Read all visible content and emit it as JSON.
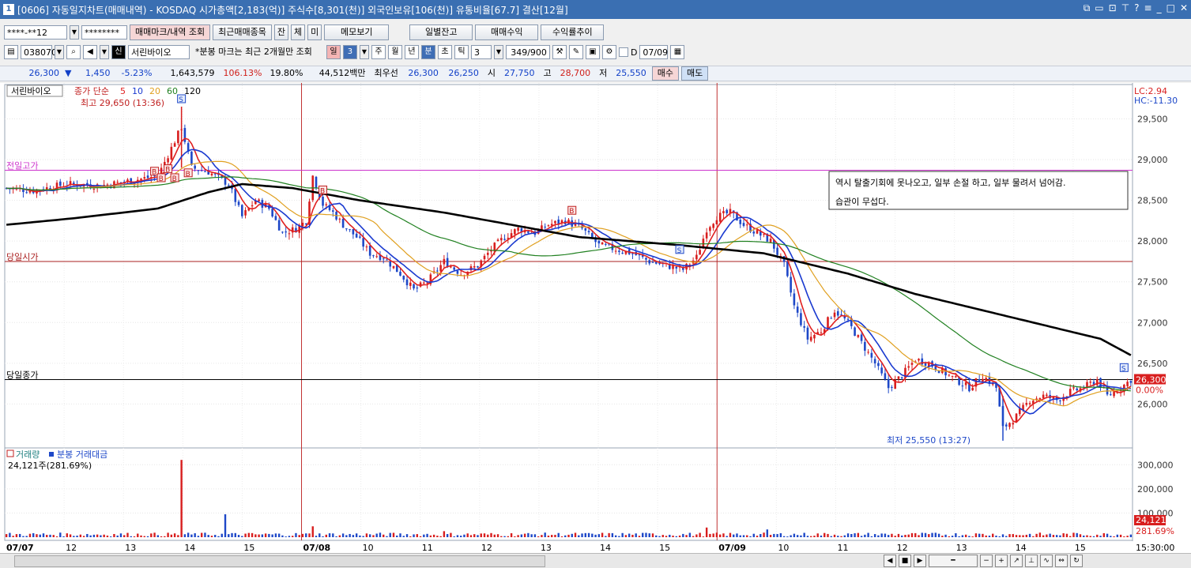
{
  "window": {
    "number": "1",
    "title": "[0606] 자동일지차트(매매내역) - KOSDAQ 시가총액[2,183(억)] 주식수[8,301(천)] 외국인보유[106(천)] 유통비율[67.7] 결산[12월]"
  },
  "toolbar1": {
    "account": "****-**12",
    "password": "********",
    "btn_trade_marks": "매매마크/내역 조회",
    "btn_recent_items": "최근매매종목",
    "btn_jan": "잔",
    "btn_che": "체",
    "btn_mi": "미",
    "btn_memo": "메모보기",
    "btn_daily_balance": "일별잔고",
    "btn_trade_profit": "매매수익",
    "btn_return_trend": "수익률추이"
  },
  "toolbar2": {
    "stock_code": "038070",
    "sin_badge": "신",
    "stock_name": "서린바이오",
    "minute_note": "*분봉 마크는 최근 2개월만 조회",
    "period_il": "일",
    "period_value": "3",
    "period_ju": "주",
    "period_wol": "월",
    "period_nyeon": "년",
    "period_bun": "분",
    "period_cho": "초",
    "period_tik": "틱",
    "interval": "3",
    "count": "349/900",
    "d_label": "D",
    "date": "07/09"
  },
  "quote": {
    "price": "26,300",
    "arrow": "▼",
    "change": "1,450",
    "rate": "-5.23%",
    "volume": "1,643,579",
    "vol_ratio": "106.13%",
    "turnover": "19.80%",
    "amount": "44,512백만",
    "best_label": "최우선",
    "ask": "26,300",
    "bid": "26,250",
    "open_label": "시",
    "open": "27,750",
    "high_label": "고",
    "high": "28,700",
    "low_label": "저",
    "low": "25,550",
    "buy_btn": "매수",
    "sell_btn": "매도"
  },
  "chart_data": {
    "type": "candlestick",
    "stock_label": "서린바이오",
    "legend_price": "종가 단순",
    "ma_periods": [
      "5",
      "10",
      "20",
      "60",
      "120"
    ],
    "ma_colors": [
      "#e02020",
      "#1a3ad0",
      "#e0a020",
      "#208020",
      "#000000"
    ],
    "high_note": "최고 29,650 (13:36)",
    "low_note": "최저 25,550 (13:27)",
    "lc": "LC:2.94",
    "hc": "HC:-11.30",
    "ylim": [
      25500,
      29650
    ],
    "y_ticks": [
      {
        "v": 29500,
        "label": "29,500"
      },
      {
        "v": 29000,
        "label": "29,000"
      },
      {
        "v": 28500,
        "label": "28,500"
      },
      {
        "v": 28000,
        "label": "28,000"
      },
      {
        "v": 27500,
        "label": "27,500"
      },
      {
        "v": 27000,
        "label": "27,000"
      },
      {
        "v": 26500,
        "label": "26,500"
      },
      {
        "v": 26000,
        "label": "26,000"
      }
    ],
    "hlines": [
      {
        "label": "전일고가",
        "value": 28870,
        "color": "#cc33cc"
      },
      {
        "label": "당일시가",
        "value": 27750,
        "color": "#aa2020"
      },
      {
        "label": "당일종가",
        "value": 26300,
        "color": "#000000"
      }
    ],
    "current_price_tag": "26,300",
    "current_rate_tag": "0.00%",
    "annotation": [
      "역시 탈출기회에 못나오고, 일부 손절 하고, 일부 물려서 넘어감.",
      "습관이 무섭다."
    ],
    "x_labels": [
      {
        "label": "07/07",
        "bold": true
      },
      {
        "label": "12"
      },
      {
        "label": "13"
      },
      {
        "label": "14"
      },
      {
        "label": "15"
      },
      {
        "label": "07/08",
        "bold": true
      },
      {
        "label": "10"
      },
      {
        "label": "11"
      },
      {
        "label": "12"
      },
      {
        "label": "13"
      },
      {
        "label": "14"
      },
      {
        "label": "15"
      },
      {
        "label": "07/09",
        "bold": true
      },
      {
        "label": "10"
      },
      {
        "label": "11"
      },
      {
        "label": "12"
      },
      {
        "label": "13"
      },
      {
        "label": "14"
      },
      {
        "label": "15"
      }
    ],
    "time_right": "15:30:00",
    "close_path": [
      [
        0,
        28650
      ],
      [
        8,
        28620
      ],
      [
        18,
        28700
      ],
      [
        28,
        28680
      ],
      [
        38,
        28750
      ],
      [
        45,
        28800
      ],
      [
        52,
        29400
      ],
      [
        55,
        28900
      ],
      [
        60,
        28850
      ],
      [
        66,
        28700
      ],
      [
        70,
        28300
      ],
      [
        74,
        28500
      ],
      [
        78,
        28400
      ],
      [
        82,
        28100
      ],
      [
        86,
        28150
      ],
      [
        89,
        28250
      ],
      [
        91,
        28800
      ],
      [
        94,
        28450
      ],
      [
        97,
        28350
      ],
      [
        100,
        28200
      ],
      [
        104,
        28050
      ],
      [
        108,
        27850
      ],
      [
        112,
        27800
      ],
      [
        117,
        27600
      ],
      [
        121,
        27400
      ],
      [
        125,
        27500
      ],
      [
        130,
        27750
      ],
      [
        135,
        27600
      ],
      [
        140,
        27700
      ],
      [
        144,
        27900
      ],
      [
        148,
        28050
      ],
      [
        152,
        28150
      ],
      [
        157,
        28100
      ],
      [
        161,
        28200
      ],
      [
        166,
        28250
      ],
      [
        171,
        28150
      ],
      [
        176,
        27950
      ],
      [
        181,
        27900
      ],
      [
        186,
        27850
      ],
      [
        191,
        27750
      ],
      [
        196,
        27700
      ],
      [
        201,
        27650
      ],
      [
        205,
        27800
      ],
      [
        208,
        28150
      ],
      [
        211,
        28300
      ],
      [
        215,
        28350
      ],
      [
        219,
        28200
      ],
      [
        223,
        28100
      ],
      [
        227,
        28000
      ],
      [
        231,
        27700
      ],
      [
        234,
        27200
      ],
      [
        238,
        26800
      ],
      [
        242,
        26900
      ],
      [
        246,
        27150
      ],
      [
        250,
        27000
      ],
      [
        254,
        26750
      ],
      [
        258,
        26500
      ],
      [
        262,
        26200
      ],
      [
        266,
        26350
      ],
      [
        270,
        26550
      ],
      [
        274,
        26500
      ],
      [
        278,
        26400
      ],
      [
        282,
        26300
      ],
      [
        286,
        26200
      ],
      [
        290,
        26350
      ],
      [
        294,
        26200
      ],
      [
        296,
        25700
      ],
      [
        300,
        25850
      ],
      [
        304,
        26050
      ],
      [
        308,
        26100
      ],
      [
        312,
        26050
      ],
      [
        316,
        26150
      ],
      [
        320,
        26200
      ],
      [
        324,
        26300
      ],
      [
        327,
        26100
      ],
      [
        331,
        26200
      ],
      [
        334,
        26300
      ]
    ],
    "ma120_path": [
      [
        0,
        28200
      ],
      [
        20,
        28280
      ],
      [
        45,
        28400
      ],
      [
        60,
        28600
      ],
      [
        70,
        28700
      ],
      [
        85,
        28650
      ],
      [
        105,
        28500
      ],
      [
        130,
        28350
      ],
      [
        150,
        28200
      ],
      [
        170,
        28050
      ],
      [
        200,
        27950
      ],
      [
        225,
        27850
      ],
      [
        250,
        27600
      ],
      [
        270,
        27350
      ],
      [
        290,
        27150
      ],
      [
        310,
        26950
      ],
      [
        325,
        26800
      ],
      [
        334,
        26600
      ]
    ],
    "volume_label": "거래량",
    "volume_sub": "분봉 거래대금",
    "volume_value": "24,121주(281.69%)",
    "volume_ticks": [
      {
        "v": 300000,
        "label": "300,000"
      },
      {
        "v": 200000,
        "label": "200,000"
      },
      {
        "v": 100000,
        "label": "100,000"
      }
    ],
    "volume_ylim": [
      0,
      350000
    ],
    "volume_tag": "24,121",
    "volume_tag2": "281.69%",
    "volume_spikes": [
      [
        52,
        320000
      ],
      [
        65,
        95000
      ],
      [
        91,
        45000
      ],
      [
        130,
        25000
      ],
      [
        208,
        40000
      ],
      [
        226,
        32000
      ]
    ],
    "bars_total": 335
  },
  "icons": {
    "close": "close-icon",
    "minimize": "minimize-icon",
    "restore": "restore-icon",
    "search": "search-icon"
  }
}
